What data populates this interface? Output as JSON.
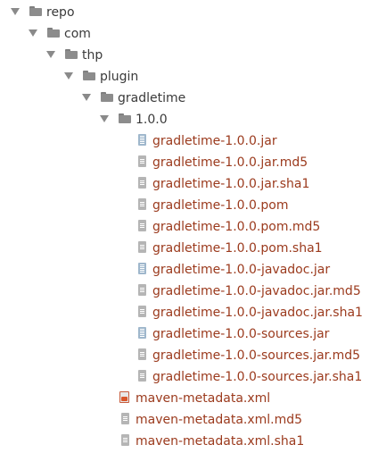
{
  "tree": {
    "folders": {
      "repo": "repo",
      "com": "com",
      "thp": "thp",
      "plugin": "plugin",
      "gradletime": "gradletime",
      "version": "1.0.0"
    },
    "version_files": [
      {
        "name": "gradletime-1.0.0.jar",
        "icon": "jar-file-icon"
      },
      {
        "name": "gradletime-1.0.0.jar.md5",
        "icon": "text-file-icon"
      },
      {
        "name": "gradletime-1.0.0.jar.sha1",
        "icon": "text-file-icon"
      },
      {
        "name": "gradletime-1.0.0.pom",
        "icon": "text-file-icon"
      },
      {
        "name": "gradletime-1.0.0.pom.md5",
        "icon": "text-file-icon"
      },
      {
        "name": "gradletime-1.0.0.pom.sha1",
        "icon": "text-file-icon"
      },
      {
        "name": "gradletime-1.0.0-javadoc.jar",
        "icon": "jar-file-icon"
      },
      {
        "name": "gradletime-1.0.0-javadoc.jar.md5",
        "icon": "text-file-icon"
      },
      {
        "name": "gradletime-1.0.0-javadoc.jar.sha1",
        "icon": "text-file-icon"
      },
      {
        "name": "gradletime-1.0.0-sources.jar",
        "icon": "jar-file-icon"
      },
      {
        "name": "gradletime-1.0.0-sources.jar.md5",
        "icon": "text-file-icon"
      },
      {
        "name": "gradletime-1.0.0-sources.jar.sha1",
        "icon": "text-file-icon"
      }
    ],
    "metadata_files": [
      {
        "name": "maven-metadata.xml",
        "icon": "xml-file-icon"
      },
      {
        "name": "maven-metadata.xml.md5",
        "icon": "text-file-icon"
      },
      {
        "name": "maven-metadata.xml.sha1",
        "icon": "text-file-icon"
      }
    ]
  },
  "colors": {
    "folder_text": "#3a3a3a",
    "file_text": "#9b3a1d",
    "arrow": "#8a8a8a",
    "folder_icon": "#8c8c8c",
    "xml_badge": "#d9572c"
  }
}
